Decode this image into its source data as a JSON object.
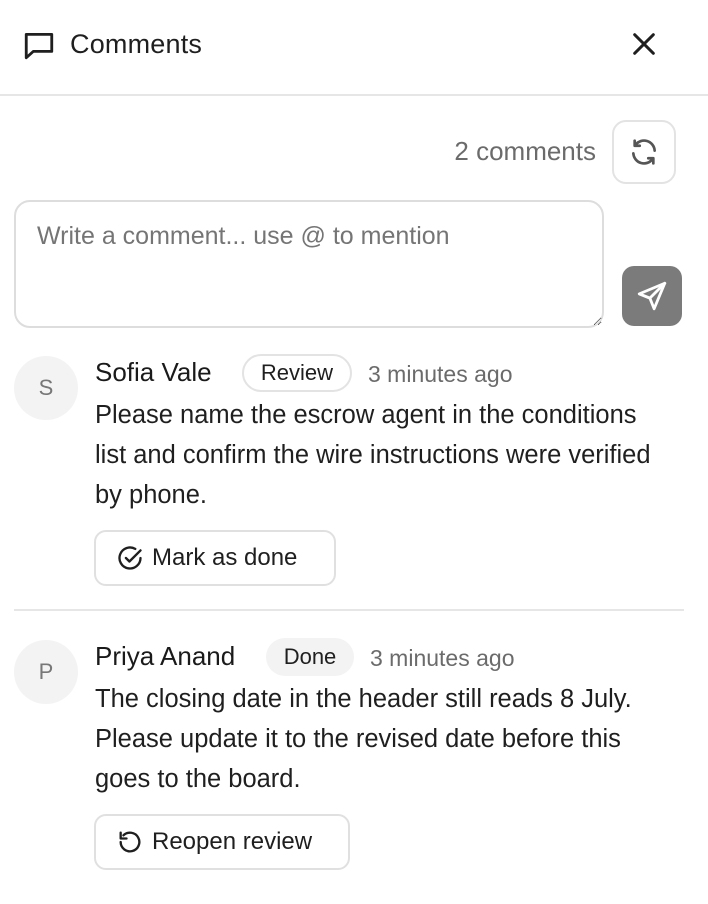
{
  "header": {
    "title": "Comments",
    "title_icon": "message-square-icon",
    "close_icon": "close-icon"
  },
  "toolbar": {
    "count_label": "2 comments",
    "refresh_icon": "refresh-icon"
  },
  "composer": {
    "placeholder": "Write a comment... use @ to mention",
    "value": "",
    "send_icon": "send-icon"
  },
  "comments": [
    {
      "initial": "S",
      "author": "Sofia Vale",
      "status": "Review",
      "time": "3 minutes ago",
      "text": "Please name the escrow agent in the conditions list and confirm the wire instructions were verified by phone.",
      "action_label": "Mark as done",
      "action_icon": "check-circle-icon"
    },
    {
      "initial": "P",
      "author": "Priya Anand",
      "status": "Done",
      "time": "3 minutes ago",
      "text": "The closing date in the header still reads 8 July. Please update it to the revised date before this goes to the board.",
      "action_label": "Reopen review",
      "action_icon": "rotate-ccw-icon"
    }
  ],
  "colors": {
    "send_button": "#7b7b7b",
    "border": "#e3e3e3",
    "muted_text": "#6b6b6b"
  }
}
